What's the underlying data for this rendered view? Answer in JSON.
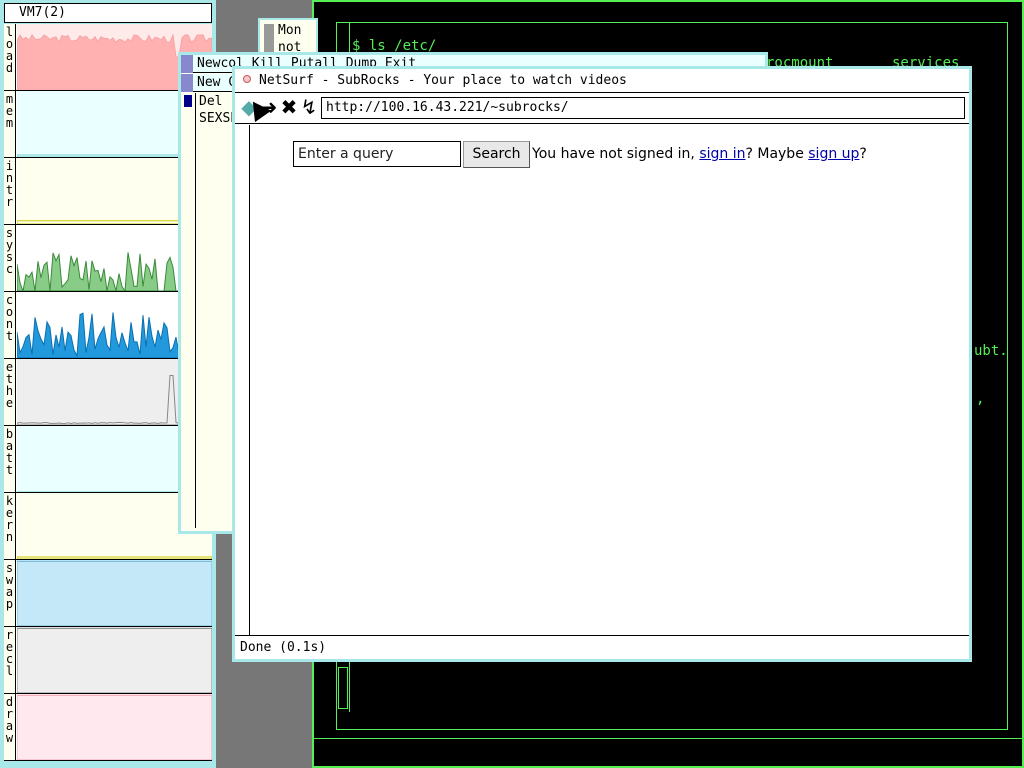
{
  "stats": {
    "title": "VM7(2)",
    "panels": [
      {
        "label": "load",
        "color": "#f5a5a5",
        "fill": "#ffb0b0"
      },
      {
        "label": "mem",
        "color": "#6fd0d0",
        "fill": "#eaffff"
      },
      {
        "label": "intr",
        "color": "#c8c800",
        "fill": "#fffff0"
      },
      {
        "label": "sysc",
        "color": "#3a8a3a",
        "fill": "#88cc88"
      },
      {
        "label": "cont",
        "color": "#0a70b0",
        "fill": "#2299dd"
      },
      {
        "label": "ethe",
        "color": "#888888",
        "fill": "#eeeeee"
      },
      {
        "label": "batt",
        "color": "#6fd0d0",
        "fill": "#eaffff"
      },
      {
        "label": "kern",
        "color": "#c8c800",
        "fill": "#fffff0"
      },
      {
        "label": "swap",
        "color": "#6fb8d8",
        "fill": "#c4e8f8"
      },
      {
        "label": "recl",
        "color": "#888888",
        "fill": "#eeeeee"
      },
      {
        "label": "draw",
        "color": "#f5a5b5",
        "fill": "#ffe8ee"
      }
    ]
  },
  "terminal": {
    "prompt_line": "$ ls /etc/",
    "frag1": "rocmount",
    "frag2": "services",
    "frag3": "ubt.",
    "frag4": ","
  },
  "acme": {
    "tag": "Newcol Kill Putall Dump Exit",
    "col_tag": "New C",
    "line1": "Del",
    "line2": "SEXSE",
    "small_win_line1": "Mon",
    "small_win_line2": "not"
  },
  "netsurf": {
    "title": "NetSurf - SubRocks - Your place to watch videos",
    "url": "http://100.16.43.221/~subrocks/",
    "query_placeholder": "Enter a query",
    "search_label": "Search",
    "sign_prefix": "You have not signed in, ",
    "sign_in": "sign in",
    "sign_mid": "? Maybe ",
    "sign_up": "sign up",
    "sign_suffix": "?",
    "status": "Done (0.1s)"
  }
}
